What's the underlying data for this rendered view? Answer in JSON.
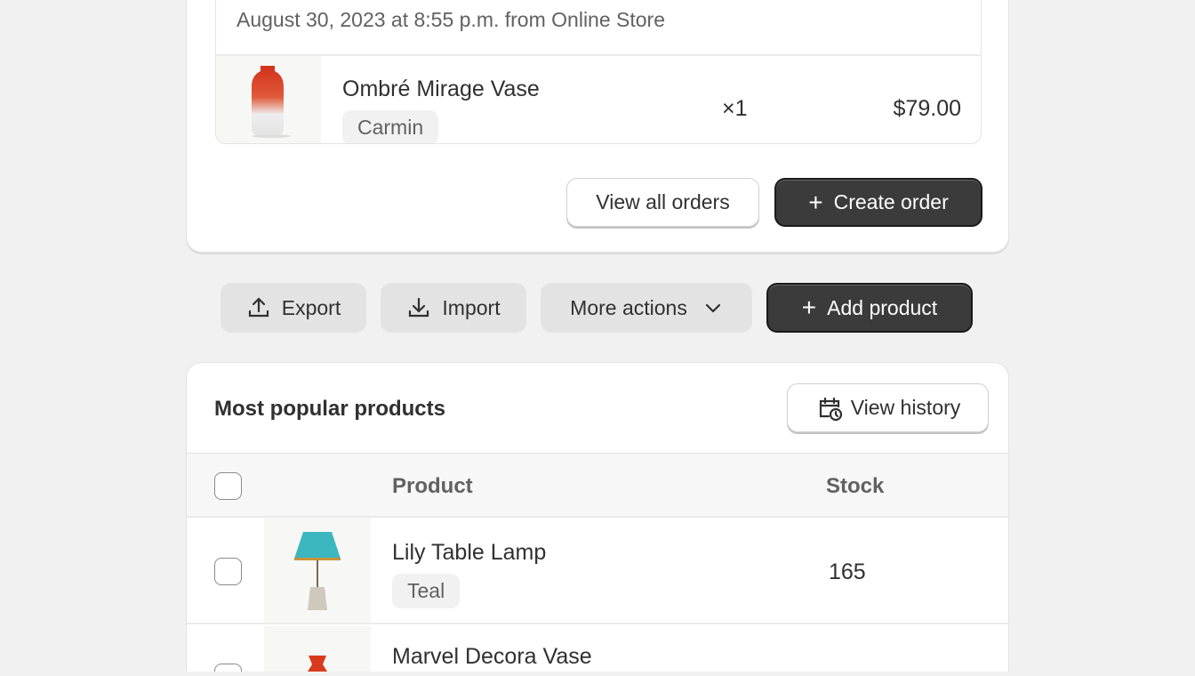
{
  "order": {
    "date": "August 30, 2023 at 8:55 p.m. from Online Store",
    "item": {
      "name": "Ombré Mirage Vase",
      "variant": "Carmin",
      "quantity": "×1",
      "price": "$79.00"
    },
    "view_all_label": "View all orders",
    "create_label": "Create order"
  },
  "actions": {
    "export": "Export",
    "import": "Import",
    "more": "More actions",
    "add": "Add product"
  },
  "products": {
    "title": "Most popular products",
    "view_history": "View history",
    "columns": [
      "Product",
      "Stock"
    ],
    "rows": [
      {
        "name": "Lily Table Lamp",
        "variant": "Teal",
        "stock": "165"
      },
      {
        "name": "Marvel Decora Vase"
      }
    ]
  },
  "colors": {
    "primary": "#3b3b3b",
    "background": "#f1f1f1"
  }
}
